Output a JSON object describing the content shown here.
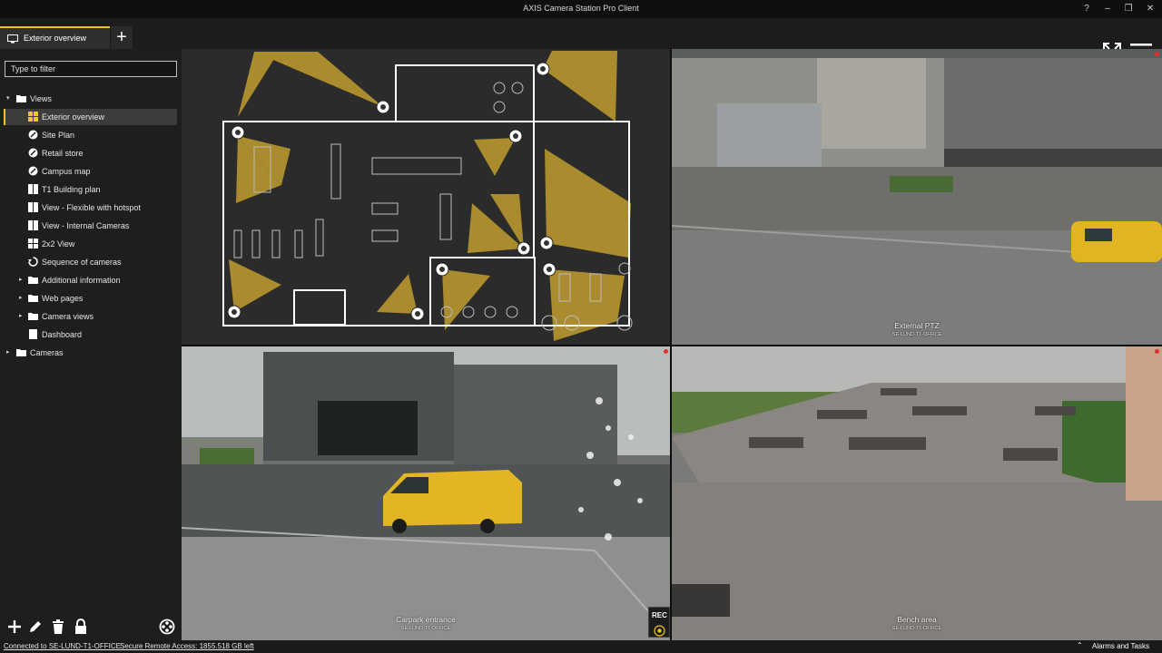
{
  "window": {
    "title": "AXIS Camera Station Pro Client",
    "controls": [
      "?",
      "–",
      "❐",
      "✕"
    ]
  },
  "tabs": [
    {
      "label": "Exterior overview",
      "icon": "monitor-icon"
    }
  ],
  "sidebar": {
    "filter_placeholder": "Type to filter",
    "tree": [
      {
        "label": "Views",
        "icon": "folder-icon",
        "expanded": true
      },
      {
        "label": "Exterior overview",
        "icon": "grid-view-icon",
        "selected": true
      },
      {
        "label": "Site Plan",
        "icon": "map-icon"
      },
      {
        "label": "Retail store",
        "icon": "map-icon"
      },
      {
        "label": "Campus map",
        "icon": "map-icon"
      },
      {
        "label": "T1 Building plan",
        "icon": "split-view-icon"
      },
      {
        "label": "View - Flexible with hotspot",
        "icon": "split-view-icon"
      },
      {
        "label": "View - Internal Cameras",
        "icon": "split-view-icon"
      },
      {
        "label": "2x2 View",
        "icon": "grid-view-icon"
      },
      {
        "label": "Sequence of cameras",
        "icon": "sequence-icon"
      },
      {
        "label": "Additional information",
        "icon": "folder-icon",
        "expanded": false
      },
      {
        "label": "Web pages",
        "icon": "folder-icon",
        "expanded": false
      },
      {
        "label": "Camera views",
        "icon": "folder-icon",
        "expanded": false
      },
      {
        "label": "Dashboard",
        "icon": "page-icon"
      },
      {
        "label": "Cameras",
        "icon": "folder-icon",
        "expanded": false
      }
    ],
    "tools": [
      "add-icon",
      "edit-icon",
      "delete-icon",
      "lock-icon",
      "film-reel-icon"
    ]
  },
  "panes": {
    "floorplan": {
      "name": "Floor plan map"
    },
    "external_ptz": {
      "label": "External PTZ",
      "sub": "SE-LUND-T1-OFFICE"
    },
    "carpark": {
      "label": "Carpark entrance",
      "sub": "SE-LUND-T1-OFFICE",
      "rec": "REC"
    },
    "bench": {
      "label": "Bench area",
      "sub": "SE-LUND-T1-OFFICE"
    }
  },
  "status": {
    "connected": "Connected to SE-LUND-T1-OFFICE",
    "remote": "Secure Remote Access: 1855.518 GB left",
    "alarms": "Alarms and Tasks"
  },
  "colors": {
    "accent": "#f0c419",
    "rec": "#e0312b",
    "cone": "#b8962e"
  }
}
